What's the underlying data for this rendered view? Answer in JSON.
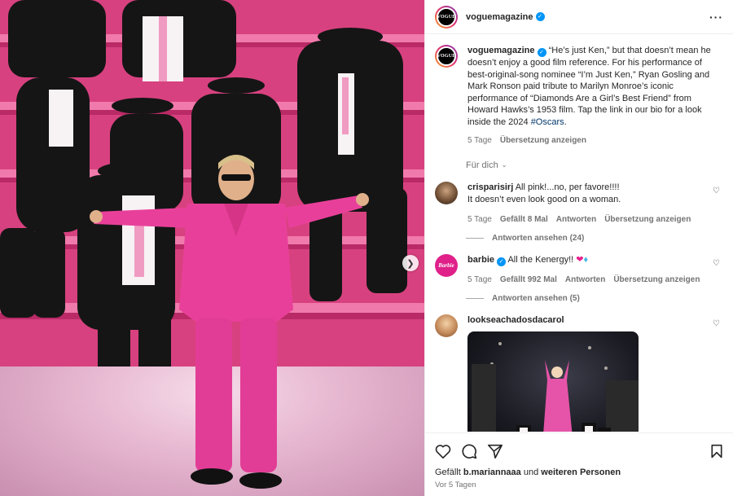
{
  "post": {
    "author": "voguemagazine",
    "author_avatar_text": "VOGUE",
    "caption": "“He’s just Ken,” but that doesn’t mean he doesn’t enjoy a good film reference. For his performance of best-original-song nominee “I’m Just Ken,” Ryan Gosling and Mark Ronson paid tribute to Marilyn Monroe’s iconic performance of “Diamonds Are a Girl’s Best Friend” from Howard Hawks’s 1953 film. Tap the link in our bio for a look inside the 2024",
    "hashtag": "#Oscars",
    "hashtag_suffix": ".",
    "age": "5 Tage",
    "translate": "Übersetzung anzeigen"
  },
  "filter_label": "Für dich",
  "comments": [
    {
      "user": "crisparisirj",
      "text_line1": "All pink!...no, per favore!!!!",
      "text_line2": "It doesn’t even look good on a woman.",
      "age": "5 Tage",
      "likes": "Gefällt 8 Mal",
      "reply": "Antworten",
      "translate": "Übersetzung anzeigen",
      "view_replies": "Antworten ansehen (24)"
    },
    {
      "user": "barbie",
      "avatar_text": "Barbie",
      "text": "All the Kenergy!!",
      "age": "5 Tage",
      "likes": "Gefällt 992 Mal",
      "reply": "Antworten",
      "translate": "Übersetzung anzeigen",
      "view_replies": "Antworten ansehen (5)"
    },
    {
      "user": "lookseachadosdacarol"
    }
  ],
  "footer": {
    "liked_by_prefix": "Gefällt",
    "liked_by_user": "b.mariannaaa",
    "liked_by_mid": "und",
    "liked_by_rest": "weiteren Personen",
    "date": "Vor 5 Tagen"
  },
  "colors": {
    "link": "#00376b",
    "verified": "#0095f6",
    "muted": "#737373",
    "pink_suit": "#e8409a"
  },
  "icons": [
    "more-icon",
    "verified-icon",
    "chevron-down-icon",
    "heart-icon",
    "comment-icon",
    "share-icon",
    "bookmark-icon",
    "chevron-right-icon"
  ]
}
